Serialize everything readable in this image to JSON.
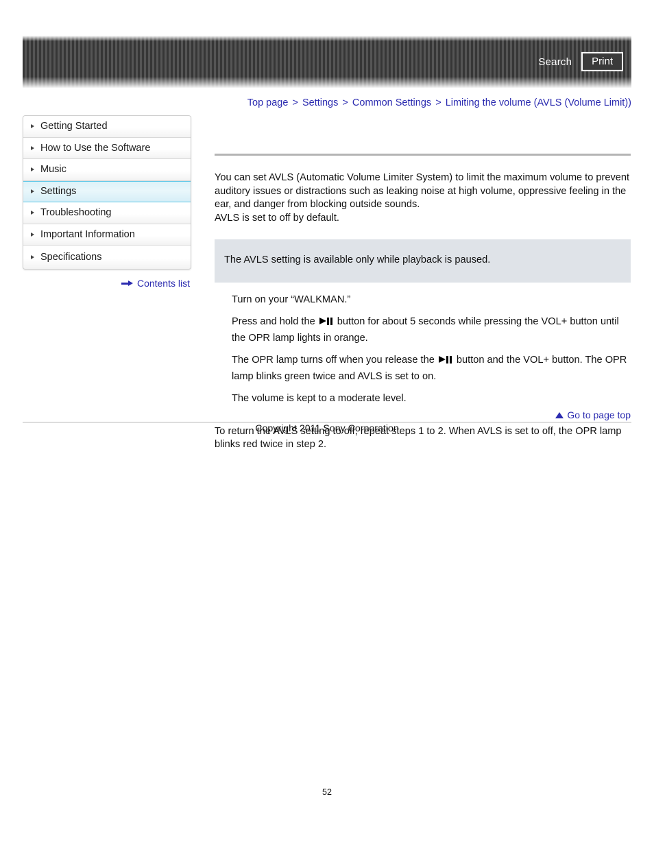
{
  "header": {
    "search_label": "Search",
    "print_label": "Print"
  },
  "breadcrumb": {
    "items": [
      {
        "label": "Top page"
      },
      {
        "label": "Settings"
      },
      {
        "label": "Common Settings"
      },
      {
        "label": "Limiting the volume (AVLS (Volume Limit))"
      }
    ],
    "separator": ">"
  },
  "sidebar": {
    "items": [
      {
        "label": "Getting Started",
        "selected": false
      },
      {
        "label": "How to Use the Software",
        "selected": false
      },
      {
        "label": "Music",
        "selected": false
      },
      {
        "label": "Settings",
        "selected": true
      },
      {
        "label": "Troubleshooting",
        "selected": false
      },
      {
        "label": "Important Information",
        "selected": false
      },
      {
        "label": "Specifications",
        "selected": false
      }
    ],
    "contents_list_label": "Contents list"
  },
  "main": {
    "intro_paragraph": "You can set AVLS (Automatic Volume Limiter System) to limit the maximum volume to prevent auditory issues or distractions such as leaking noise at high volume, oppressive feeling in the ear, and danger from blocking outside sounds.",
    "intro_paragraph_2": "AVLS is set to off by default.",
    "note": "The AVLS setting is available only while playback is paused.",
    "steps": [
      {
        "text_before": "Turn on your “WALKMAN.”",
        "has_icon": false,
        "text_after": ""
      },
      {
        "text_before": "Press and hold the ",
        "has_icon": true,
        "text_after": " button for about 5 seconds while pressing the VOL+ button until the OPR lamp lights in orange."
      },
      {
        "text_before": "The OPR lamp turns off when you release the ",
        "has_icon": true,
        "text_after": " button and the VOL+ button. The OPR lamp blinks green twice and AVLS is set to on."
      },
      {
        "text_before": "The volume is kept to a moderate level.",
        "has_icon": false,
        "text_after": ""
      }
    ],
    "closing_paragraph": "To return the AVLS setting to off, repeat steps 1 to 2. When AVLS is set to off, the OPR lamp blinks red twice in step 2."
  },
  "footer": {
    "go_to_top_label": "Go to page top",
    "copyright": "Copyright 2011 Sony Corporation",
    "page_number": "52"
  },
  "colors": {
    "link": "#2b2bb0",
    "selected_nav": "#ddf2f8",
    "note_box": "#dfe3e8",
    "rule": "#b4b4b4"
  }
}
